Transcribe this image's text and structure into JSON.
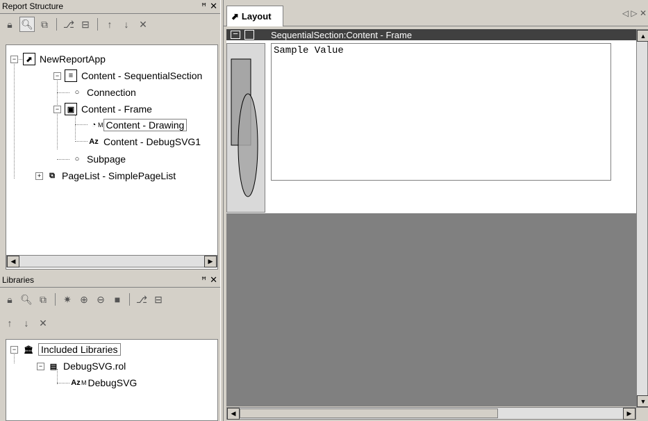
{
  "report_structure": {
    "title": "Report Structure",
    "pin": "p",
    "close": "✕",
    "tree": {
      "root": "NewReportApp",
      "section": "Content - SequentialSection",
      "connection": "Connection",
      "frame": "Content - Frame",
      "drawing": "Content - Drawing",
      "drawing_badge": "M",
      "debug": "Content - DebugSVG1",
      "subpage": "Subpage",
      "pagelist": "PageList - SimplePageList"
    }
  },
  "libraries": {
    "title": "Libraries",
    "tree": {
      "root": "Included Libraries",
      "file": "DebugSVG.rol",
      "item": "DebugSVG",
      "item_badge": "M"
    }
  },
  "layout": {
    "tab": "Layout",
    "header": "SequentialSection:Content - Frame",
    "sample": "Sample Value",
    "nav": "◁ ▷ ✕"
  },
  "colors": {
    "canvas_gray": "#808080",
    "header_bg": "#404040"
  }
}
